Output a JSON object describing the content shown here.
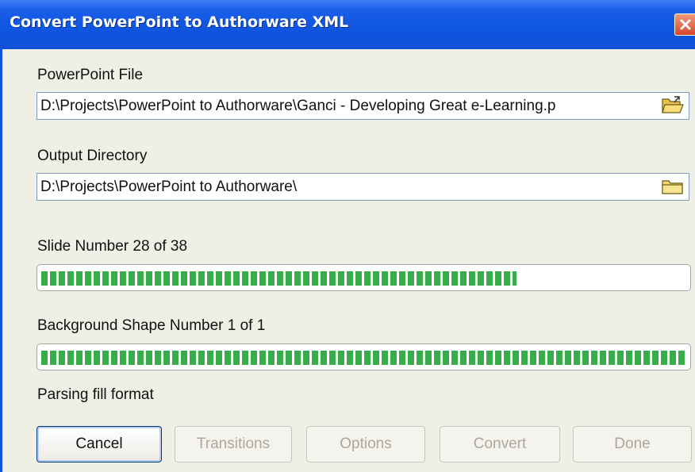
{
  "window": {
    "title": "Convert PowerPoint to Authorware XML",
    "close_icon": "close-icon"
  },
  "powerpoint_file": {
    "label": "PowerPoint File",
    "value": "D:\\Projects\\PowerPoint to Authorware\\Ganci - Developing Great e-Learning.p",
    "browse_icon": "open-folder-icon"
  },
  "output_directory": {
    "label": "Output Directory",
    "value": "D:\\Projects\\PowerPoint to Authorware\\",
    "browse_icon": "folder-icon"
  },
  "slide_progress": {
    "label": "Slide Number 28 of 38",
    "fraction": 0.737
  },
  "shape_progress": {
    "label": "Background Shape Number 1 of 1",
    "fraction": 1.0
  },
  "status": {
    "text": "Parsing fill format"
  },
  "buttons": {
    "cancel": "Cancel",
    "transitions": "Transitions",
    "options": "Options",
    "convert": "Convert",
    "done": "Done"
  },
  "colors": {
    "title_bar": "#0f55e0",
    "progress_fill": "#37ad4a",
    "dialog_background": "#f0efe6"
  }
}
